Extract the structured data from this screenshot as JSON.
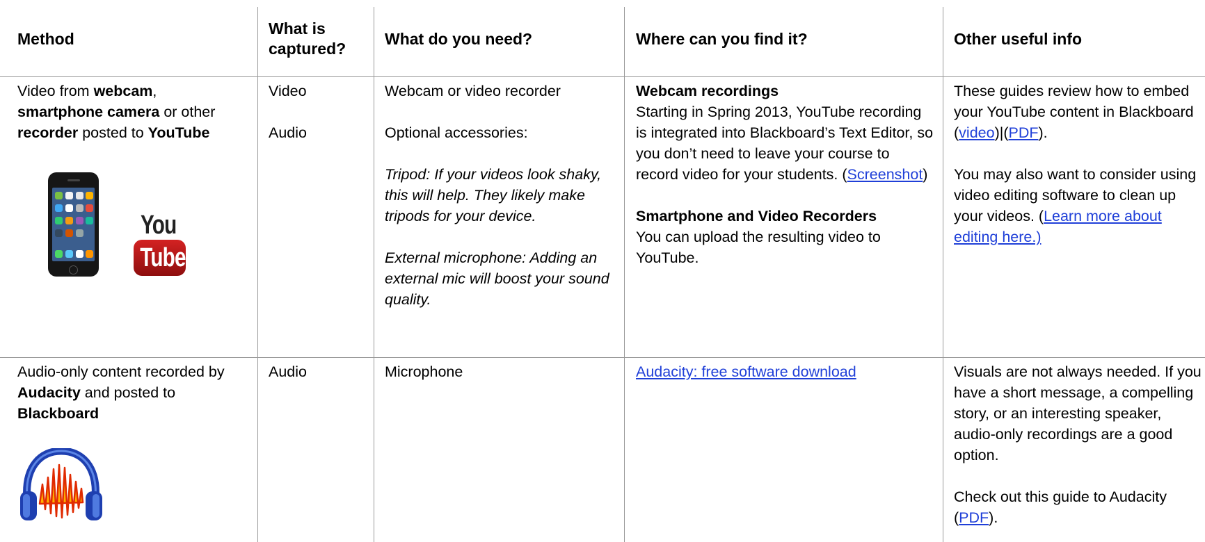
{
  "headers": {
    "method": "Method",
    "captured": "What is captured?",
    "need": "What do you need?",
    "where": "Where can you find it?",
    "info": "Other useful info"
  },
  "row1": {
    "method": {
      "t1": "Video from ",
      "b1": "webcam",
      "t2": ",",
      "b2": "smartphone camera",
      "t3": " or other",
      "b3": "recorder",
      "t4": " posted to ",
      "b4": "YouTube"
    },
    "captured": [
      "Video",
      "Audio"
    ],
    "need": {
      "line1": "Webcam or video recorder",
      "line2": "Optional accessories:",
      "tripod": "Tripod: If your videos look shaky, this will help. They likely make tripods for your device.",
      "mic": "External microphone: Adding an external mic will boost your sound quality."
    },
    "where": {
      "h1": "Webcam recordings",
      "p1": "Starting in Spring 2013, YouTube recording is integrated into Blackboard’s Text Editor, so you don’t need to leave your course to record video for your students. (",
      "link1": "Screenshot",
      "p1end": ")",
      "h2": "Smartphone and Video Recorders",
      "p2": "You can upload the resulting video to YouTube."
    },
    "info": {
      "p1": "These guides review how to embed your YouTube content in Blackboard (",
      "link_video": "video",
      "sep": ")|(",
      "link_pdf": "PDF",
      "p1end": ").",
      "p2": "You may also want to consider using video editing software to clean up your videos. (",
      "link_learn": "Learn more about editing here.)"
    },
    "logo_you": "You",
    "logo_tube": "Tube"
  },
  "row2": {
    "method": {
      "t1": "Audio-only content recorded by ",
      "b1": "Audacity",
      "t2": " and posted to ",
      "b2": "Blackboard"
    },
    "captured": "Audio",
    "need": "Microphone",
    "where_link": "Audacity: free software download",
    "info": {
      "p1": "Visuals are not always needed. If you have a short message, a compelling story, or an interesting speaker, audio-only recordings are a good option.",
      "p2": "Check out this guide to Audacity (",
      "link_pdf": "PDF",
      "p2end": ")."
    }
  }
}
